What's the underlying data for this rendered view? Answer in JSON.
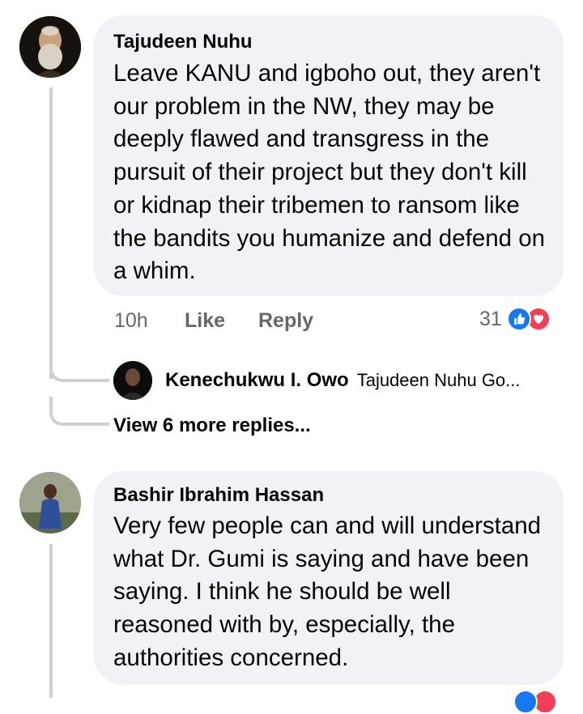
{
  "comments": [
    {
      "author": "Tajudeen Nuhu",
      "text": "Leave KANU and igboho out, they aren't our problem in the NW, they may be deeply flawed and transgress in the pursuit of their project but they don't kill or kidnap their tribemen to ransom like the bandits you humanize and defend on a whim.",
      "time": "10h",
      "like_label": "Like",
      "reply_label": "Reply",
      "reaction_count": "31",
      "reply_preview": {
        "author": "Kenechukwu I. Owo",
        "snippet": "Tajudeen Nuhu Go..."
      },
      "view_more": "View 6 more replies..."
    },
    {
      "author": "Bashir Ibrahim Hassan",
      "text": "Very few people can and will understand what Dr. Gumi is saying and have been saying. I think he should be well reasoned with by, especially, the authorities concerned."
    }
  ],
  "icons": {
    "like": "thumbs-up-icon",
    "love": "heart-icon"
  },
  "colors": {
    "bubble": "#f0f2f5",
    "meta": "#65676b",
    "like": "#1877f2",
    "love": "#f33e58"
  }
}
